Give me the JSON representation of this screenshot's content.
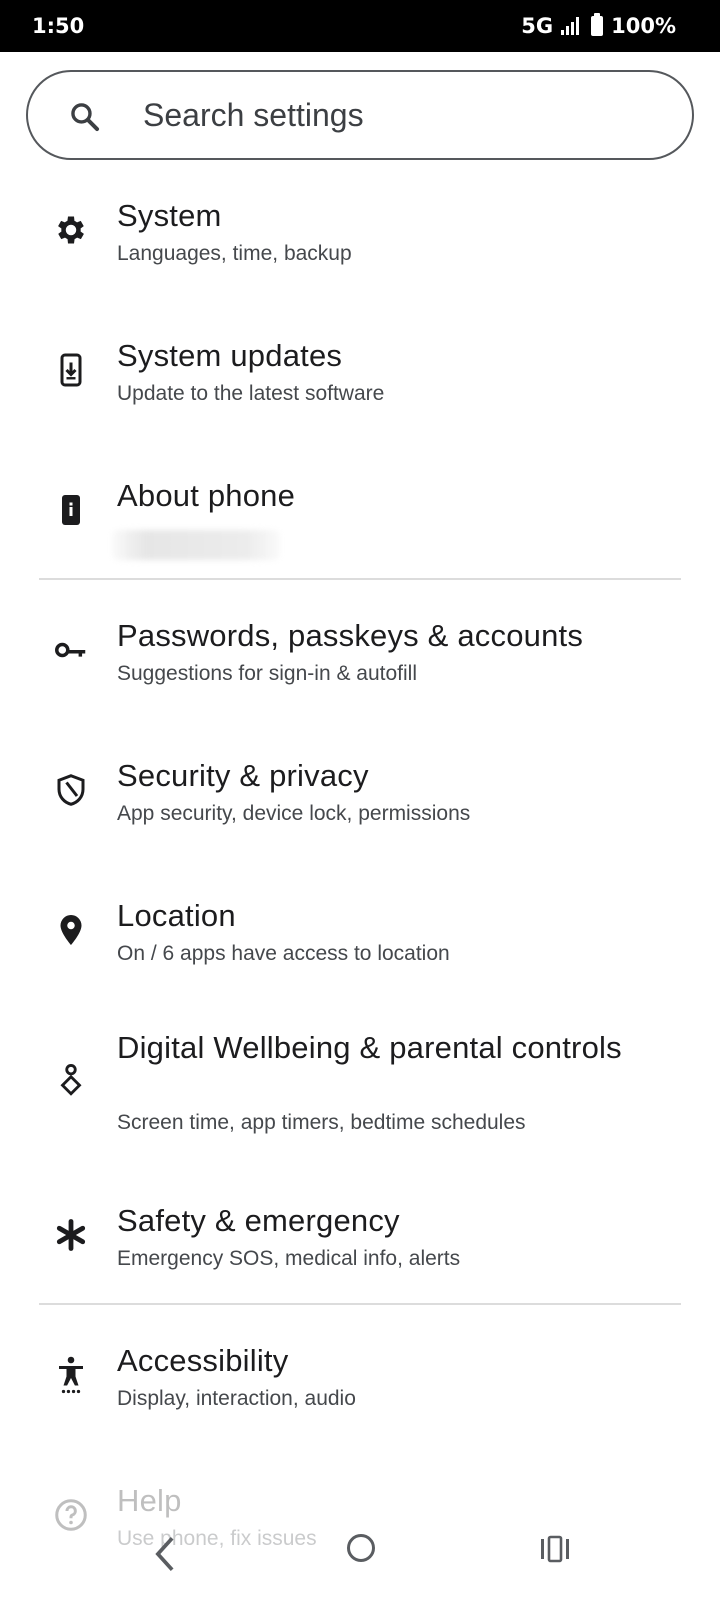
{
  "status_bar": {
    "time": "1:50",
    "network": "5G",
    "battery": "100%"
  },
  "search": {
    "placeholder": "Search settings"
  },
  "items": [
    {
      "title": "System",
      "subtitle": "Languages, time, backup",
      "icon": "gear-icon"
    },
    {
      "title": "System updates",
      "subtitle": "Update to the latest software",
      "icon": "system-update-icon"
    },
    {
      "title": "About phone",
      "subtitle": "",
      "icon": "info-icon"
    },
    {
      "title": "Passwords, passkeys & accounts",
      "subtitle": "Suggestions for sign-in & autofill",
      "icon": "key-icon"
    },
    {
      "title": "Security & privacy",
      "subtitle": "App security, device lock, permissions",
      "icon": "shield-icon"
    },
    {
      "title": "Location",
      "subtitle": "On / 6 apps have access to location",
      "icon": "location-pin-icon"
    },
    {
      "title": "Digital Wellbeing & parental controls",
      "subtitle": "Screen time, app timers, bedtime schedules",
      "icon": "wellbeing-icon"
    },
    {
      "title": "Safety & emergency",
      "subtitle": "Emergency SOS, medical info, alerts",
      "icon": "asterisk-icon"
    },
    {
      "title": "Accessibility",
      "subtitle": "Display, interaction, audio",
      "icon": "accessibility-icon"
    },
    {
      "title": "Help",
      "subtitle": "Use phone, fix issues",
      "icon": "help-icon"
    }
  ],
  "nav_bar": {
    "icons": [
      "back-icon",
      "home-icon",
      "recents-icon"
    ]
  }
}
